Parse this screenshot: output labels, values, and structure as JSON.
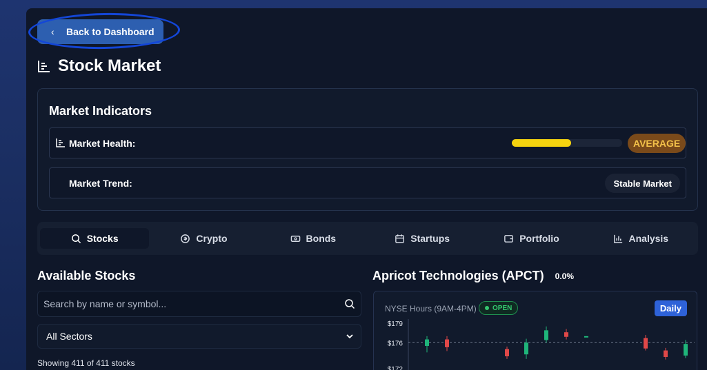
{
  "nav": {
    "back_label": "Back to Dashboard"
  },
  "page": {
    "title": "Stock Market"
  },
  "indicators": {
    "title": "Market Indicators",
    "health": {
      "label": "Market Health:",
      "level": 0.54,
      "status": "AVERAGE",
      "bar_color": "#f5d30f"
    },
    "trend": {
      "label": "Market Trend:",
      "value": "Stable Market"
    }
  },
  "tabs": [
    {
      "label": "Stocks",
      "icon": "search-icon",
      "active": true
    },
    {
      "label": "Crypto",
      "icon": "coin-icon",
      "active": false
    },
    {
      "label": "Bonds",
      "icon": "banknote-icon",
      "active": false
    },
    {
      "label": "Startups",
      "icon": "calendar-icon",
      "active": false
    },
    {
      "label": "Portfolio",
      "icon": "wallet-icon",
      "active": false
    },
    {
      "label": "Analysis",
      "icon": "bar-chart-icon",
      "active": false
    }
  ],
  "stocks": {
    "title": "Available Stocks",
    "search_placeholder": "Search by name or symbol...",
    "sector": "All Sectors",
    "count_text": "Showing 411 of 411 stocks"
  },
  "detail": {
    "name": "Apricot Technologies (APCT)",
    "change": "0.0%",
    "hours": "NYSE Hours (9AM-4PM)",
    "status": "OPEN",
    "interval": "Daily"
  },
  "colors": {
    "up": "#1fb57a",
    "down": "#e04848",
    "accent": "#2e62d8"
  },
  "chart_data": {
    "type": "candlestick",
    "y_ticks": [
      "$179",
      "$176",
      "$172"
    ],
    "ylim": [
      172,
      179
    ],
    "reference_line": 176,
    "candles": [
      {
        "open": 175.5,
        "close": 176.5,
        "high": 177.0,
        "low": 174.5
      },
      {
        "open": 176.5,
        "close": 175.3,
        "high": 177.0,
        "low": 174.7
      },
      {
        "open": 175.0,
        "close": 173.9,
        "high": 175.4,
        "low": 173.5
      },
      {
        "open": 174.2,
        "close": 176.0,
        "high": 176.6,
        "low": 173.5
      },
      {
        "open": 176.4,
        "close": 177.9,
        "high": 178.5,
        "low": 176.0
      },
      {
        "open": 177.6,
        "close": 176.9,
        "high": 178.1,
        "low": 176.5
      },
      {
        "open": 176.9,
        "close": 177.0,
        "high": 177.0,
        "low": 176.9
      },
      {
        "open": 176.7,
        "close": 175.1,
        "high": 177.2,
        "low": 174.8
      },
      {
        "open": 174.8,
        "close": 173.8,
        "high": 175.2,
        "low": 173.4
      },
      {
        "open": 174.0,
        "close": 175.8,
        "high": 176.4,
        "low": 173.6
      }
    ]
  }
}
